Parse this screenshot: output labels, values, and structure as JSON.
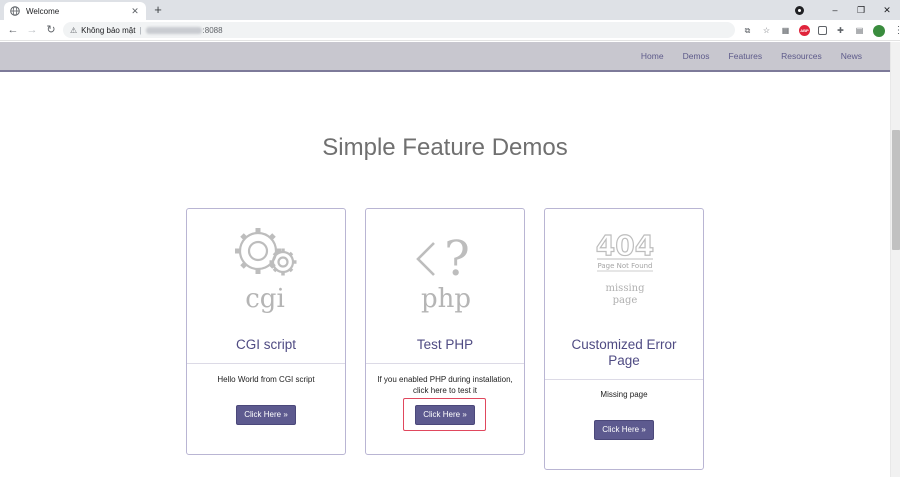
{
  "browser": {
    "tab_title": "Welcome",
    "tab_close": "✕",
    "new_tab": "+",
    "security_label": "Không bảo mật",
    "address_port": ":8088",
    "window_controls": {
      "minimize": "–",
      "restore": "❐",
      "close": "✕"
    },
    "menu_glyph": "⋮"
  },
  "site_nav": {
    "links": [
      "Home",
      "Demos",
      "Features",
      "Resources",
      "News"
    ]
  },
  "page": {
    "heading": "Simple Feature Demos"
  },
  "cards": [
    {
      "icon": "gears-cgi-icon",
      "icon_caption": "cgi",
      "title": "CGI script",
      "description": "Hello World from CGI script",
      "button_label": "Click Here »"
    },
    {
      "icon": "php-icon",
      "icon_caption": "php",
      "title": "Test PHP",
      "description_line1": "If you enabled PHP during installation,",
      "description_line2": "click here to test it",
      "button_label": "Click Here »",
      "highlighted": true
    },
    {
      "icon": "404-icon",
      "icon_code": "404",
      "icon_sub": "Page Not Found",
      "icon_caption_line1": "missing",
      "icon_caption_line2": "page",
      "title_line1": "Customized Error",
      "title_line2": "Page",
      "description": "Missing page",
      "button_label": "Click Here »"
    }
  ],
  "colors": {
    "nav_bg": "#c8c7cf",
    "accent": "#5d5a8f",
    "highlight": "#e0475d",
    "card_border": "#b9b5d3"
  }
}
